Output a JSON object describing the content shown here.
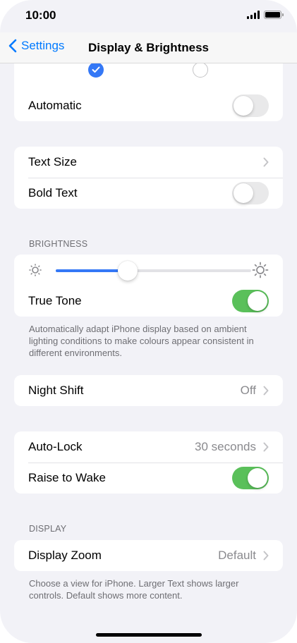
{
  "status_bar": {
    "time": "10:00",
    "icons": [
      "cellular-signal-icon",
      "battery-icon"
    ]
  },
  "nav": {
    "back_label": "Settings",
    "title": "Display & Brightness"
  },
  "appearance": {
    "light_selected": true,
    "dark_selected": false,
    "automatic_label": "Automatic",
    "automatic_on": false
  },
  "text_group": {
    "text_size_label": "Text Size",
    "bold_text_label": "Bold Text",
    "bold_text_on": false
  },
  "brightness": {
    "header": "BRIGHTNESS",
    "level": 0.37,
    "true_tone_label": "True Tone",
    "true_tone_on": true,
    "footer": "Automatically adapt iPhone display based on ambient lighting conditions to make colours appear consistent in different environments."
  },
  "night_shift": {
    "label": "Night Shift",
    "value": "Off"
  },
  "lock_group": {
    "auto_lock_label": "Auto-Lock",
    "auto_lock_value": "30 seconds",
    "raise_to_wake_label": "Raise to Wake",
    "raise_to_wake_on": true
  },
  "display": {
    "header": "DISPLAY",
    "zoom_label": "Display Zoom",
    "zoom_value": "Default",
    "footer": "Choose a view for iPhone. Larger Text shows larger controls. Default shows more content."
  },
  "colors": {
    "accent": "#007aff",
    "toggle_on": "#5ac05a",
    "slider_fill": "#3478f6",
    "background": "#f2f2f7"
  }
}
